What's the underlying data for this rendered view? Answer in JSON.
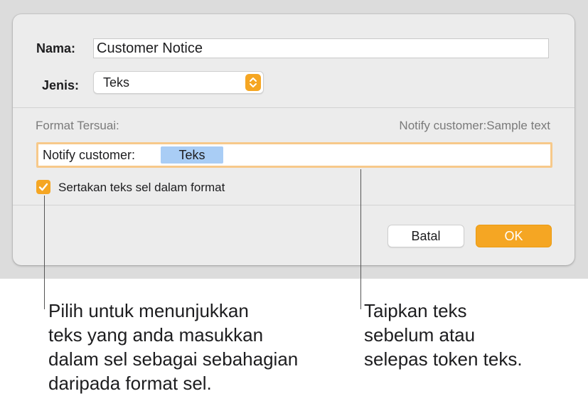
{
  "dialog": {
    "name_label": "Nama:",
    "name_value": "Customer Notice",
    "type_label": "Jenis:",
    "type_value": "Teks",
    "custom_format_label": "Format Tersuai:",
    "format_preview": "Notify customer:Sample text",
    "format_prefix_text": "Notify customer:",
    "format_token": "Teks",
    "include_checkbox_label": "Sertakan teks sel dalam format",
    "include_checkbox_checked": true,
    "cancel_label": "Batal",
    "ok_label": "OK"
  },
  "callouts": {
    "left": [
      "Pilih untuk menunjukkan",
      "teks yang anda masukkan",
      "dalam sel sebagai sebahagian",
      "daripada format sel."
    ],
    "right": [
      "Taipkan teks",
      "sebelum atau",
      "selepas token teks."
    ]
  },
  "colors": {
    "accent": "#f5a623",
    "token_bg": "#a9cdf5",
    "focus_ring": "#f7c98a"
  }
}
